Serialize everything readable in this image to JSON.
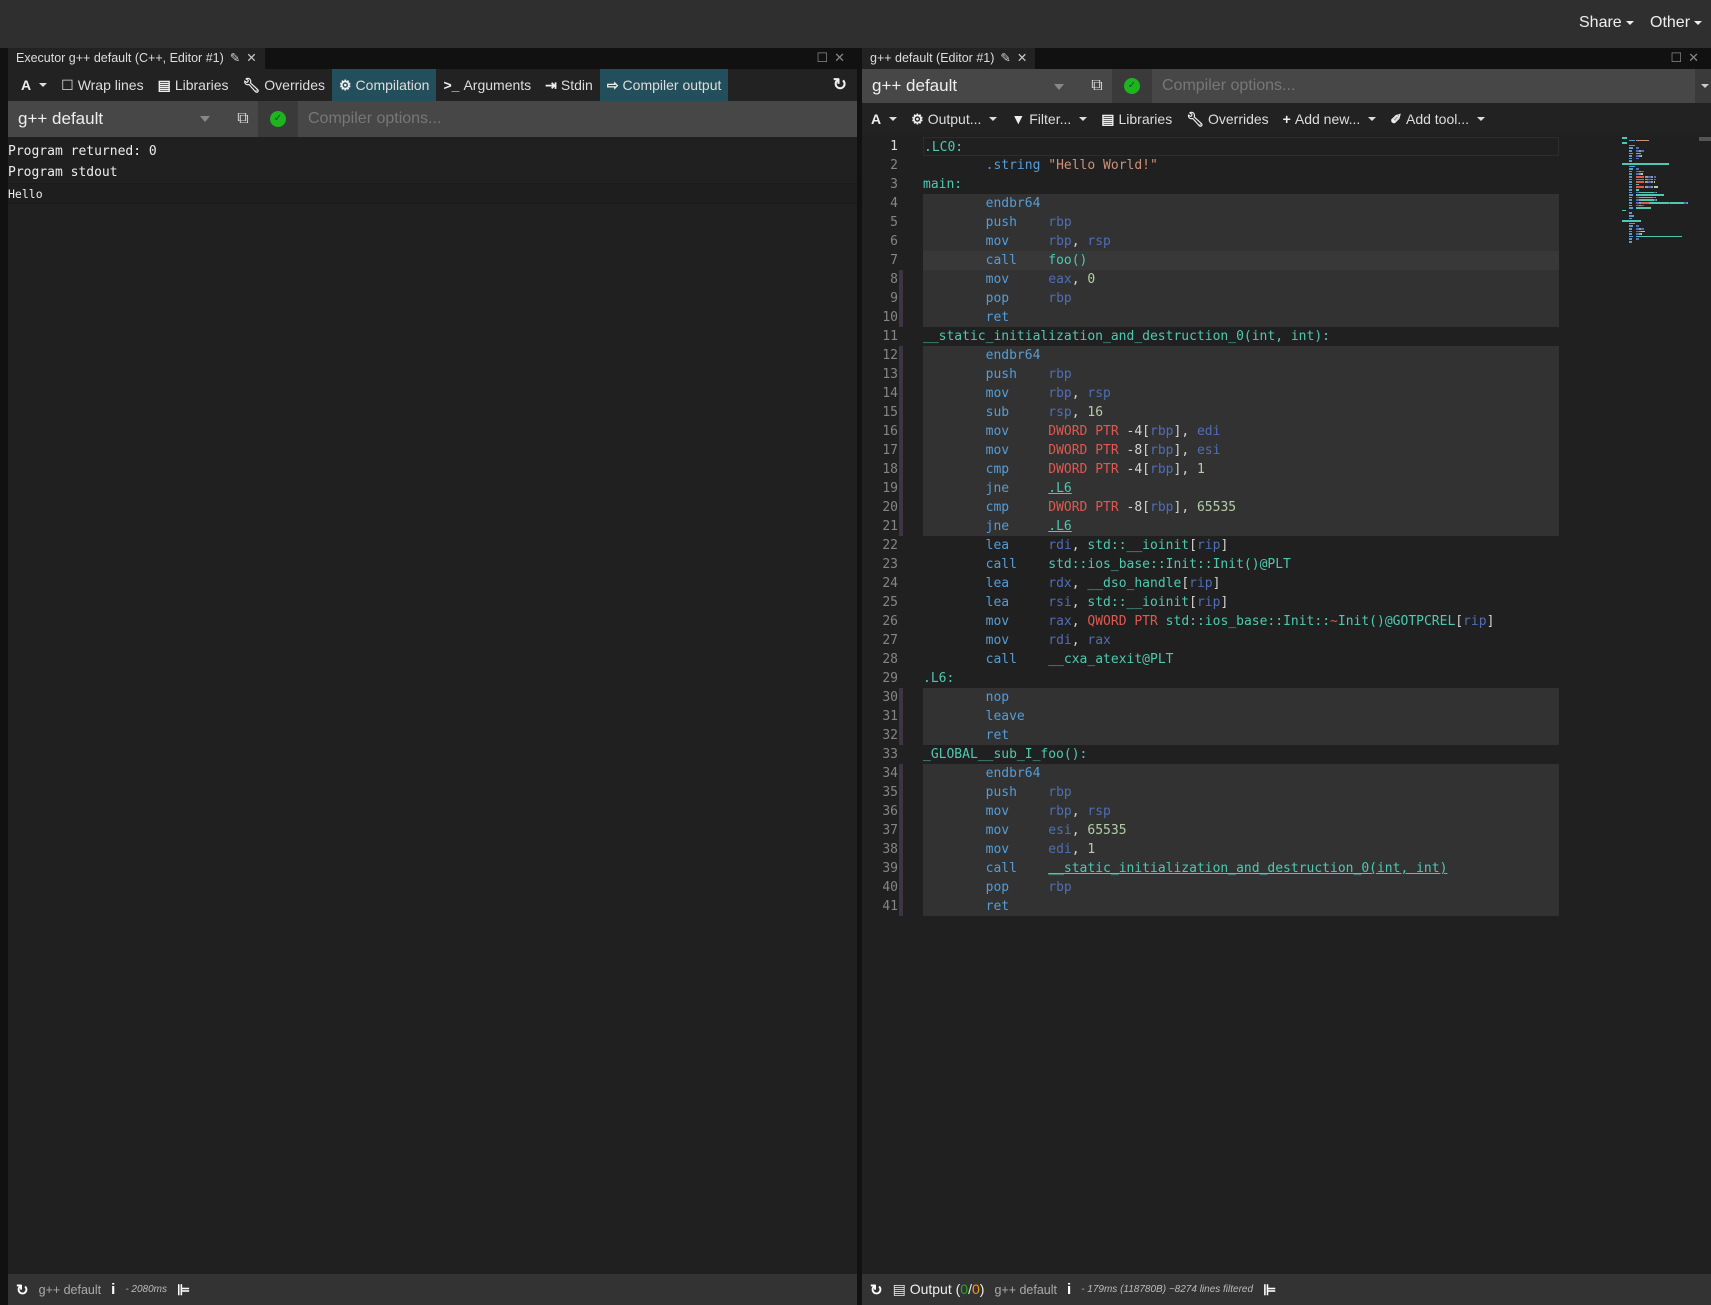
{
  "topbar": {
    "share": "Share",
    "other": "Other"
  },
  "left": {
    "tab_title": "Executor g++ default (C++, Editor #1)",
    "toolbar": {
      "font": "A",
      "wrap": "Wrap lines",
      "libraries": "Libraries",
      "overrides": "Overrides",
      "compilation": "Compilation",
      "arguments": "Arguments",
      "stdin": "Stdin",
      "compiler_output": "Compiler output"
    },
    "compiler": "g++ default",
    "options_placeholder": "Compiler options...",
    "output": [
      "Program returned: 0",
      "Program stdout",
      "Hello"
    ],
    "status": {
      "compiler": "g++ default",
      "time": "- 2080ms"
    }
  },
  "right": {
    "tab_title": "g++ default (Editor #1)",
    "compiler": "g++ default",
    "options_placeholder": "Compiler options...",
    "toolbar": {
      "font": "A",
      "output": "Output...",
      "filter": "Filter...",
      "libraries": "Libraries",
      "overrides": "Overrides",
      "add_new": "Add new...",
      "add_tool": "Add tool..."
    },
    "status": {
      "output_label": "Output (",
      "ok": "0",
      "sep": "/",
      "warn": "0",
      "close": ")",
      "compiler": "g++ default",
      "info": "- 179ms (118780B) ~8274 lines filtered"
    },
    "asm": [
      [
        [
          ".LC0:",
          "l"
        ]
      ],
      [
        [
          "        ",
          ""
        ],
        [
          ".string",
          "m"
        ],
        [
          " ",
          ""
        ],
        [
          "\"Hello World!\"",
          "s"
        ]
      ],
      [
        [
          "main:",
          "l"
        ]
      ],
      [
        [
          "        ",
          ""
        ],
        [
          "endbr64",
          "m"
        ]
      ],
      [
        [
          "        ",
          ""
        ],
        [
          "push",
          "m"
        ],
        [
          "    ",
          ""
        ],
        [
          "rbp",
          "r"
        ]
      ],
      [
        [
          "        ",
          ""
        ],
        [
          "mov",
          "m"
        ],
        [
          "     ",
          ""
        ],
        [
          "rbp",
          "r"
        ],
        [
          ", ",
          "p"
        ],
        [
          "rsp",
          "r"
        ]
      ],
      [
        [
          "        ",
          ""
        ],
        [
          "call",
          "m"
        ],
        [
          "    ",
          ""
        ],
        [
          "foo()",
          "l"
        ]
      ],
      [
        [
          "        ",
          ""
        ],
        [
          "mov",
          "m"
        ],
        [
          "     ",
          ""
        ],
        [
          "eax",
          "r"
        ],
        [
          ", ",
          "p"
        ],
        [
          "0",
          "n"
        ]
      ],
      [
        [
          "        ",
          ""
        ],
        [
          "pop",
          "m"
        ],
        [
          "     ",
          ""
        ],
        [
          "rbp",
          "r"
        ]
      ],
      [
        [
          "        ",
          ""
        ],
        [
          "ret",
          "m"
        ]
      ],
      [
        [
          "__static_initialization_and_destruction_0(int, int):",
          "l"
        ]
      ],
      [
        [
          "        ",
          ""
        ],
        [
          "endbr64",
          "m"
        ]
      ],
      [
        [
          "        ",
          ""
        ],
        [
          "push",
          "m"
        ],
        [
          "    ",
          ""
        ],
        [
          "rbp",
          "r"
        ]
      ],
      [
        [
          "        ",
          ""
        ],
        [
          "mov",
          "m"
        ],
        [
          "     ",
          ""
        ],
        [
          "rbp",
          "r"
        ],
        [
          ", ",
          "p"
        ],
        [
          "rsp",
          "r"
        ]
      ],
      [
        [
          "        ",
          ""
        ],
        [
          "sub",
          "m"
        ],
        [
          "     ",
          ""
        ],
        [
          "rsp",
          "r"
        ],
        [
          ", ",
          "p"
        ],
        [
          "16",
          "n"
        ]
      ],
      [
        [
          "        ",
          ""
        ],
        [
          "mov",
          "m"
        ],
        [
          "     ",
          ""
        ],
        [
          "DWORD PTR",
          "k"
        ],
        [
          " -4[",
          "p"
        ],
        [
          "rbp",
          "r"
        ],
        [
          "], ",
          "p"
        ],
        [
          "edi",
          "r"
        ]
      ],
      [
        [
          "        ",
          ""
        ],
        [
          "mov",
          "m"
        ],
        [
          "     ",
          ""
        ],
        [
          "DWORD PTR",
          "k"
        ],
        [
          " -8[",
          "p"
        ],
        [
          "rbp",
          "r"
        ],
        [
          "], ",
          "p"
        ],
        [
          "esi",
          "r"
        ]
      ],
      [
        [
          "        ",
          ""
        ],
        [
          "cmp",
          "m"
        ],
        [
          "     ",
          ""
        ],
        [
          "DWORD PTR",
          "k"
        ],
        [
          " -4[",
          "p"
        ],
        [
          "rbp",
          "r"
        ],
        [
          "], ",
          "p"
        ],
        [
          "1",
          "n"
        ]
      ],
      [
        [
          "        ",
          ""
        ],
        [
          "jne",
          "m"
        ],
        [
          "     ",
          ""
        ],
        [
          ".L6",
          "u"
        ]
      ],
      [
        [
          "        ",
          ""
        ],
        [
          "cmp",
          "m"
        ],
        [
          "     ",
          ""
        ],
        [
          "DWORD PTR",
          "k"
        ],
        [
          " -8[",
          "p"
        ],
        [
          "rbp",
          "r"
        ],
        [
          "], ",
          "p"
        ],
        [
          "65535",
          "n"
        ]
      ],
      [
        [
          "        ",
          ""
        ],
        [
          "jne",
          "m"
        ],
        [
          "     ",
          ""
        ],
        [
          ".L6",
          "u"
        ]
      ],
      [
        [
          "        ",
          ""
        ],
        [
          "lea",
          "m"
        ],
        [
          "     ",
          ""
        ],
        [
          "rdi",
          "r"
        ],
        [
          ", ",
          "p"
        ],
        [
          "std::__ioinit",
          "l"
        ],
        [
          "[",
          "p"
        ],
        [
          "rip",
          "r"
        ],
        [
          "]",
          "p"
        ]
      ],
      [
        [
          "        ",
          ""
        ],
        [
          "call",
          "m"
        ],
        [
          "    ",
          ""
        ],
        [
          "std::ios_base::Init::Init()@PLT",
          "l"
        ]
      ],
      [
        [
          "        ",
          ""
        ],
        [
          "lea",
          "m"
        ],
        [
          "     ",
          ""
        ],
        [
          "rdx",
          "r"
        ],
        [
          ", ",
          "p"
        ],
        [
          "__dso_handle",
          "l"
        ],
        [
          "[",
          "p"
        ],
        [
          "rip",
          "r"
        ],
        [
          "]",
          "p"
        ]
      ],
      [
        [
          "        ",
          ""
        ],
        [
          "lea",
          "m"
        ],
        [
          "     ",
          ""
        ],
        [
          "rsi",
          "r"
        ],
        [
          ", ",
          "p"
        ],
        [
          "std::__ioinit",
          "l"
        ],
        [
          "[",
          "p"
        ],
        [
          "rip",
          "r"
        ],
        [
          "]",
          "p"
        ]
      ],
      [
        [
          "        ",
          ""
        ],
        [
          "mov",
          "m"
        ],
        [
          "     ",
          ""
        ],
        [
          "rax",
          "r"
        ],
        [
          ", ",
          "p"
        ],
        [
          "QWORD PTR",
          "k"
        ],
        [
          " ",
          "p"
        ],
        [
          "std::ios_base::Init::",
          "l"
        ],
        [
          "~",
          "k"
        ],
        [
          "Init()@GOTPCREL",
          "l"
        ],
        [
          "[",
          "p"
        ],
        [
          "rip",
          "r"
        ],
        [
          "]",
          "p"
        ]
      ],
      [
        [
          "        ",
          ""
        ],
        [
          "mov",
          "m"
        ],
        [
          "     ",
          ""
        ],
        [
          "rdi",
          "r"
        ],
        [
          ", ",
          "p"
        ],
        [
          "rax",
          "r"
        ]
      ],
      [
        [
          "        ",
          ""
        ],
        [
          "call",
          "m"
        ],
        [
          "    ",
          ""
        ],
        [
          "__cxa_atexit@PLT",
          "l"
        ]
      ],
      [
        [
          ".L6:",
          "l"
        ]
      ],
      [
        [
          "        ",
          ""
        ],
        [
          "nop",
          "m"
        ]
      ],
      [
        [
          "        ",
          ""
        ],
        [
          "leave",
          "m"
        ]
      ],
      [
        [
          "        ",
          ""
        ],
        [
          "ret",
          "m"
        ]
      ],
      [
        [
          "_GLOBAL__sub_I_foo():",
          "l"
        ]
      ],
      [
        [
          "        ",
          ""
        ],
        [
          "endbr64",
          "m"
        ]
      ],
      [
        [
          "        ",
          ""
        ],
        [
          "push",
          "m"
        ],
        [
          "    ",
          ""
        ],
        [
          "rbp",
          "r"
        ]
      ],
      [
        [
          "        ",
          ""
        ],
        [
          "mov",
          "m"
        ],
        [
          "     ",
          ""
        ],
        [
          "rbp",
          "r"
        ],
        [
          ", ",
          "p"
        ],
        [
          "rsp",
          "r"
        ]
      ],
      [
        [
          "        ",
          ""
        ],
        [
          "mov",
          "m"
        ],
        [
          "     ",
          ""
        ],
        [
          "esi",
          "r"
        ],
        [
          ", ",
          "p"
        ],
        [
          "65535",
          "n"
        ]
      ],
      [
        [
          "        ",
          ""
        ],
        [
          "mov",
          "m"
        ],
        [
          "     ",
          ""
        ],
        [
          "edi",
          "r"
        ],
        [
          ", ",
          "p"
        ],
        [
          "1",
          "n"
        ]
      ],
      [
        [
          "        ",
          ""
        ],
        [
          "call",
          "m"
        ],
        [
          "    ",
          ""
        ],
        [
          "__static_initialization_and_destruction_0(int, int)",
          "u"
        ]
      ],
      [
        [
          "        ",
          ""
        ],
        [
          "pop",
          "m"
        ],
        [
          "     ",
          ""
        ],
        [
          "rbp",
          "r"
        ]
      ],
      [
        [
          "        ",
          ""
        ],
        [
          "ret",
          "m"
        ]
      ]
    ]
  }
}
